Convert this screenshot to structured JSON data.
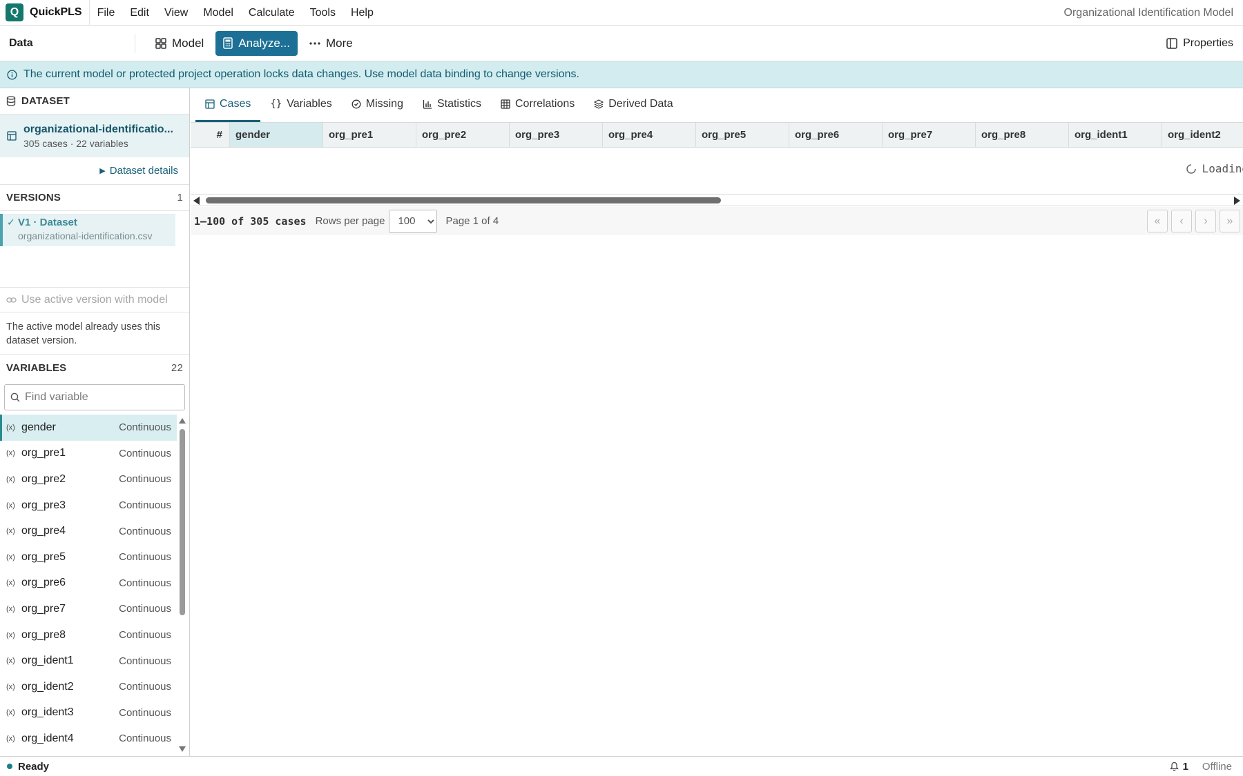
{
  "app": {
    "name": "QuickPLS",
    "logo_letter": "Q",
    "window_title": "Organizational Identification Model"
  },
  "menu": [
    "File",
    "Edit",
    "View",
    "Model",
    "Calculate",
    "Tools",
    "Help"
  ],
  "toolbar": {
    "section": "Data",
    "model_label": "Model",
    "analyze_label": "Analyze...",
    "more_label": "More",
    "properties_label": "Properties"
  },
  "banner": {
    "text": "The current model or protected project operation locks data changes. Use model data binding to change versions."
  },
  "dataset": {
    "heading": "DATASET",
    "name": "organizational-identificatio...",
    "meta": "305 cases · 22 variables",
    "details_label": "Dataset details"
  },
  "versions": {
    "heading": "VERSIONS",
    "count": "1",
    "items": [
      {
        "title": "V1 · Dataset",
        "file": "organizational-identification.csv"
      }
    ],
    "use_active_label": "Use active version with model",
    "note": "The active model already uses this dataset version."
  },
  "variables": {
    "heading": "VARIABLES",
    "count": "22",
    "search_placeholder": "Find variable",
    "icon_glyph": "(x)",
    "items": [
      {
        "name": "gender",
        "type": "Continuous"
      },
      {
        "name": "org_pre1",
        "type": "Continuous"
      },
      {
        "name": "org_pre2",
        "type": "Continuous"
      },
      {
        "name": "org_pre3",
        "type": "Continuous"
      },
      {
        "name": "org_pre4",
        "type": "Continuous"
      },
      {
        "name": "org_pre5",
        "type": "Continuous"
      },
      {
        "name": "org_pre6",
        "type": "Continuous"
      },
      {
        "name": "org_pre7",
        "type": "Continuous"
      },
      {
        "name": "org_pre8",
        "type": "Continuous"
      },
      {
        "name": "org_ident1",
        "type": "Continuous"
      },
      {
        "name": "org_ident2",
        "type": "Continuous"
      },
      {
        "name": "org_ident3",
        "type": "Continuous"
      },
      {
        "name": "org_ident4",
        "type": "Continuous"
      }
    ]
  },
  "tabs": [
    "Cases",
    "Variables",
    "Missing",
    "Statistics",
    "Correlations",
    "Derived Data"
  ],
  "grid": {
    "index_header": "#",
    "columns": [
      "gender",
      "org_pre1",
      "org_pre2",
      "org_pre3",
      "org_pre4",
      "org_pre5",
      "org_pre6",
      "org_pre7",
      "org_pre8",
      "org_ident1",
      "org_ident2"
    ],
    "loading_text": "Loading"
  },
  "pager": {
    "range": "1–100 of 305 cases",
    "rows_per_page_label": "Rows per page",
    "rows_per_page": "100",
    "page_info": "Page 1 of 4",
    "first": "«",
    "prev": "‹",
    "next": "›",
    "last": "»"
  },
  "status": {
    "text": "Ready",
    "notifications": "1",
    "connection": "Offline"
  },
  "colors": {
    "brand": "#14776c",
    "primary_button": "#1c7095",
    "banner_bg": "#d3ecf0",
    "selection_bg": "#d9eef0"
  }
}
